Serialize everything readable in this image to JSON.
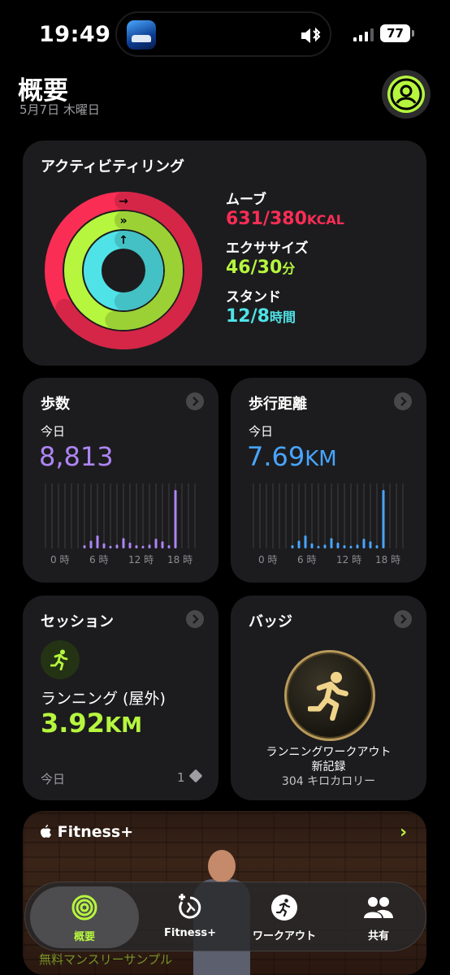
{
  "status_bar": {
    "time": "19:49",
    "battery": "77"
  },
  "header": {
    "title": "概要",
    "date": "5月7日 木曜日"
  },
  "activity": {
    "title": "アクティビティリング",
    "move": {
      "label": "ムーブ",
      "value": "631/380",
      "unit": "KCAL",
      "progress": 1.66,
      "color": "#fa2d55"
    },
    "exercise": {
      "label": "エクササイズ",
      "value": "46/30",
      "unit": "分",
      "progress": 1.53,
      "color": "#b6f63e"
    },
    "stand": {
      "label": "スタンド",
      "value": "12/8",
      "unit": "時間",
      "progress": 1.5,
      "color": "#4fe3e8"
    }
  },
  "steps": {
    "title": "歩数",
    "period": "今日",
    "value": "8,813",
    "color": "#ad85f4",
    "ticks": [
      "0 時",
      "6 時",
      "12 時",
      "18 時"
    ],
    "hourly": [
      0,
      0,
      0,
      0,
      0,
      0,
      0.05,
      0.12,
      0.2,
      0.08,
      0.04,
      0.06,
      0.16,
      0.09,
      0.05,
      0.04,
      0.06,
      0.15,
      0.11,
      0.05,
      0.9,
      0,
      0,
      0
    ]
  },
  "distance": {
    "title": "歩行距離",
    "period": "今日",
    "value": "7.69",
    "unit": "KM",
    "color": "#48a5ff",
    "ticks": [
      "0 時",
      "6 時",
      "12 時",
      "18 時"
    ],
    "hourly": [
      0,
      0,
      0,
      0,
      0,
      0,
      0.05,
      0.12,
      0.2,
      0.08,
      0.04,
      0.06,
      0.16,
      0.09,
      0.05,
      0.04,
      0.06,
      0.15,
      0.11,
      0.05,
      0.9,
      0,
      0,
      0
    ]
  },
  "session": {
    "title": "セッション",
    "name": "ランニング (屋外)",
    "value": "3.92",
    "unit": "KM",
    "period": "今日",
    "count": "1"
  },
  "badge": {
    "title": "バッジ",
    "line1": "ランニングワークアウト",
    "line2": "新記録",
    "calories": "304 キロカロリー"
  },
  "fitness_plus": {
    "title": "Fitness+",
    "footer": "無料マンスリーサンプル"
  },
  "tabbar": {
    "tabs": [
      {
        "label": "概要",
        "icon": "activity-rings-icon",
        "active": true
      },
      {
        "label": "Fitness+",
        "icon": "fitness-plus-icon",
        "active": false
      },
      {
        "label": "ワークアウト",
        "icon": "workout-runner-icon",
        "active": false
      },
      {
        "label": "共有",
        "icon": "sharing-people-icon",
        "active": false
      }
    ]
  }
}
